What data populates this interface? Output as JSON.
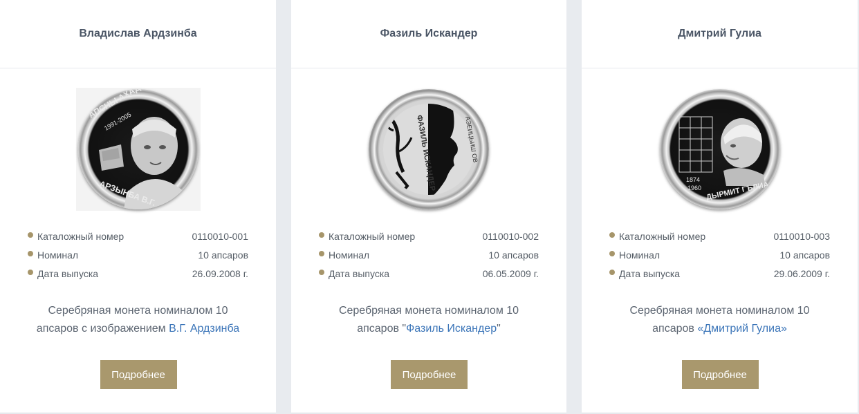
{
  "cards": [
    {
      "title": "Владислав Ардзинба",
      "coin_text": "АПСНЫ АХАДА 1991-2005 АРЗЫНБА В.Г.",
      "specs": [
        {
          "label": "Каталожный номер",
          "value": "0110010-001"
        },
        {
          "label": "Номинал",
          "value": "10 апсаров"
        },
        {
          "label": "Дата выпуска",
          "value": "26.09.2008 г."
        }
      ],
      "desc_line1": "Серебряная монета номиналом 10",
      "desc_prefix": "апсаров с изображением ",
      "desc_link": "В.Г. Ардзинба",
      "desc_suffix": "",
      "button": "Подробнее"
    },
    {
      "title": "Фазиль Искандер",
      "coin_text": "ФАЗИЛЬ ИСКАНДЕР АЭЕИЦЬИШ ОВ",
      "specs": [
        {
          "label": "Каталожный номер",
          "value": "0110010-002"
        },
        {
          "label": "Номинал",
          "value": "10 апсаров"
        },
        {
          "label": "Дата выпуска",
          "value": "06.05.2009 г."
        }
      ],
      "desc_line1": "Серебряная монета номиналом 10",
      "desc_prefix": "апсаров \"",
      "desc_link": "Фазиль Искандер",
      "desc_suffix": "\"",
      "button": "Подробнее"
    },
    {
      "title": "Дмитрий Гулиа",
      "coin_text": "1874 1960 ДЫРМИТ ГЪЛИА",
      "specs": [
        {
          "label": "Каталожный номер",
          "value": "0110010-003"
        },
        {
          "label": "Номинал",
          "value": "10 апсаров"
        },
        {
          "label": "Дата выпуска",
          "value": "29.06.2009 г."
        }
      ],
      "desc_line1": "Серебряная монета номиналом 10",
      "desc_prefix": "апсаров ",
      "desc_link": "«Дмитрий Гулиа»",
      "desc_suffix": "",
      "button": "Подробнее"
    }
  ],
  "colors": {
    "accent": "#a9986d",
    "link": "#3a74b8",
    "page_bg": "#e8ebef"
  }
}
